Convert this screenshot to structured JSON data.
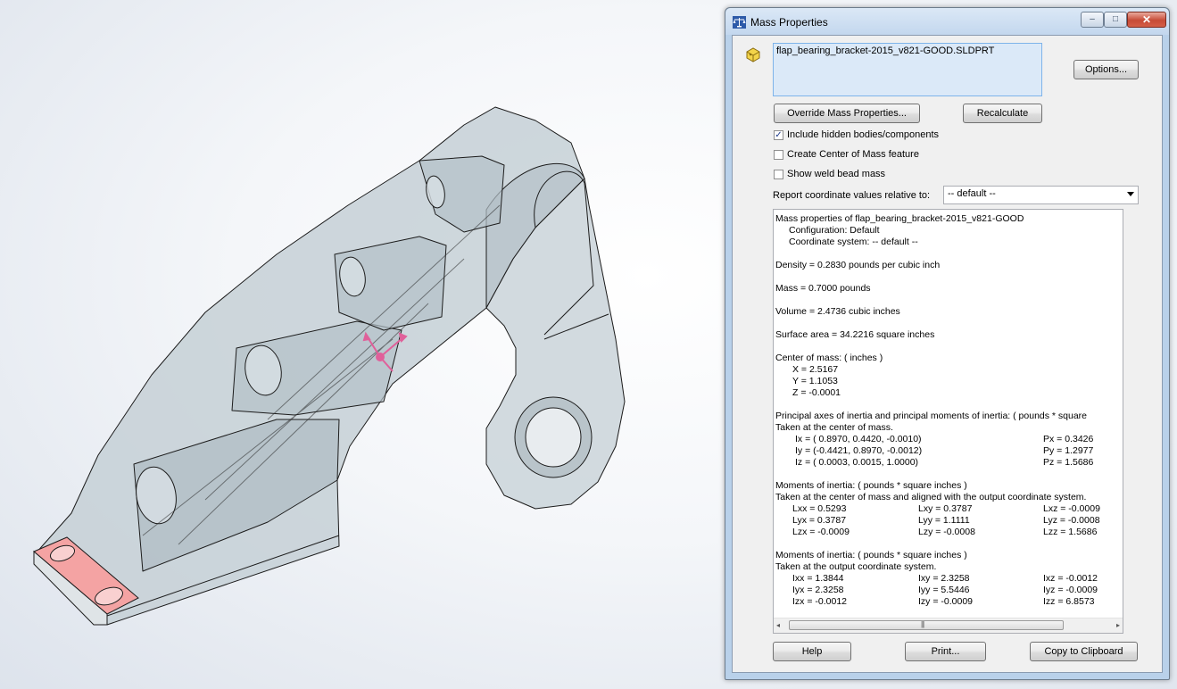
{
  "window": {
    "title": "Mass Properties",
    "close_glyph": "✕",
    "minimize_glyph": "–",
    "maximize_glyph": "□"
  },
  "file": {
    "name": "flap_bearing_bracket-2015_v821-GOOD.SLDPRT"
  },
  "buttons": {
    "options": "Options...",
    "override": "Override Mass Properties...",
    "recalculate": "Recalculate",
    "help": "Help",
    "print": "Print...",
    "copy": "Copy to Clipboard"
  },
  "checkboxes": {
    "hidden": {
      "label": "Include hidden bodies/components",
      "checked": true,
      "mark": "✓"
    },
    "com": {
      "label": "Create Center of Mass feature",
      "checked": false
    },
    "weld": {
      "label": "Show weld bead mass",
      "checked": false
    }
  },
  "coord": {
    "label": "Report coordinate values relative to:",
    "value": "-- default --"
  },
  "results": {
    "header": "Mass properties of flap_bearing_bracket-2015_v821-GOOD",
    "config": "Configuration: Default",
    "coordsys": "Coordinate system: -- default --",
    "density": "Density = 0.2830 pounds per cubic inch",
    "mass": "Mass = 0.7000 pounds",
    "volume": "Volume = 2.4736 cubic inches",
    "area": "Surface area = 34.2216 square inches",
    "com_title": "Center of mass: ( inches )",
    "com_x": "X = 2.5167",
    "com_y": "Y = 1.1053",
    "com_z": "Z = -0.0001",
    "principal_title": "Principal axes of inertia and principal moments of inertia: ( pounds * square",
    "principal_sub": "Taken at the center of mass.",
    "ix": "Ix = ( 0.8970,  0.4420, -0.0010)",
    "iy": "Iy = (-0.4421,  0.8970, -0.0012)",
    "iz": "Iz = ( 0.0003,  0.0015,  1.0000)",
    "px": "Px = 0.3426",
    "py": "Py = 1.2977",
    "pz": "Pz = 1.5686",
    "moi_title": "Moments of inertia: ( pounds * square inches )",
    "moi_sub": "Taken at the center of mass and aligned with the output coordinate system.",
    "lxx": "Lxx = 0.5293",
    "lxy": "Lxy = 0.3787",
    "lxz": "Lxz = -0.0009",
    "lyx": "Lyx = 0.3787",
    "lyy": "Lyy = 1.1111",
    "lyz": "Lyz = -0.0008",
    "lzx": "Lzx = -0.0009",
    "lzy": "Lzy = -0.0008",
    "lzz": "Lzz = 1.5686",
    "moi2_title": "Moments of inertia: ( pounds * square inches )",
    "moi2_sub": "Taken at the output coordinate system.",
    "ixx": "Ixx = 1.3844",
    "ixy": "Ixy = 2.3258",
    "ixz": "Ixz = -0.0012",
    "iyx": "Iyx = 2.3258",
    "iyy": "Iyy = 5.5446",
    "iyz": "Iyz = -0.0009",
    "izx": "Izx = -0.0012",
    "izy": "Izy = -0.0009",
    "izz": "Izz = 6.8573"
  },
  "scroll": {
    "left": "◂",
    "right": "▸",
    "grip": "|||"
  },
  "colors": {
    "part_fill": "#c9d3d8",
    "selected_face": "#f4a3a3",
    "com_marker": "#e0609a",
    "dialog_frame": "#b9d1ea"
  }
}
